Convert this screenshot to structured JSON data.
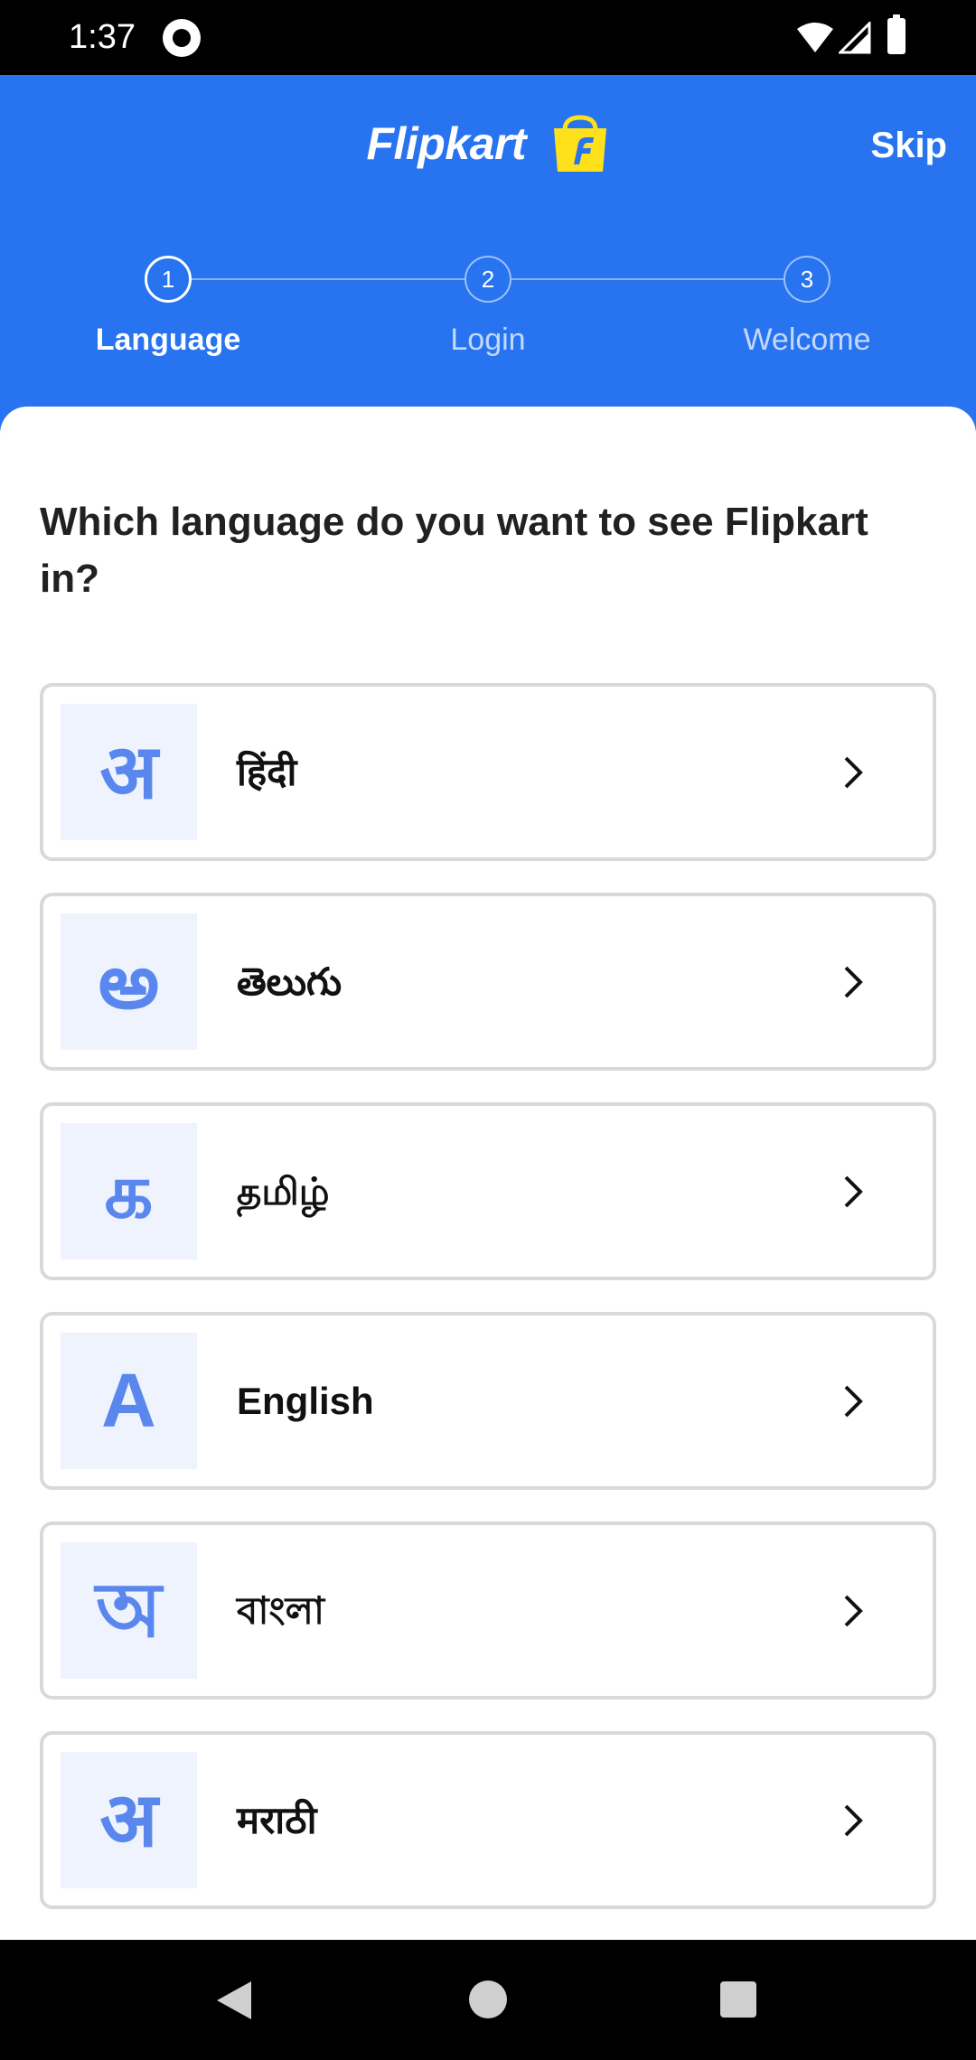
{
  "status_bar": {
    "time": "1:37"
  },
  "header": {
    "brand_name": "Flipkart",
    "skip_label": "Skip",
    "steps": [
      {
        "number": "1",
        "label": "Language",
        "active": true
      },
      {
        "number": "2",
        "label": "Login",
        "active": false
      },
      {
        "number": "3",
        "label": "Welcome",
        "active": false
      }
    ]
  },
  "main": {
    "question": "Which language do you want to see Flipkart in?",
    "languages": [
      {
        "glyph": "अ",
        "name": "हिंदी"
      },
      {
        "glyph": "అ",
        "name": "తెలుగు"
      },
      {
        "glyph": "க",
        "name": "தமிழ்"
      },
      {
        "glyph": "A",
        "name": "English"
      },
      {
        "glyph": "অ",
        "name": "বাংলা"
      },
      {
        "glyph": "अ",
        "name": "मराठी"
      }
    ]
  },
  "colors": {
    "header_blue": "#2874f0",
    "glyph_blue": "#5a87ee",
    "glyph_bg": "#eef3fe",
    "logo_yellow": "#ffe11b"
  }
}
